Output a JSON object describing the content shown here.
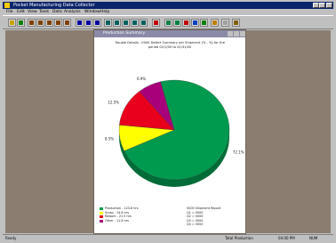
{
  "window": {
    "title": "Pocket Manufacturing Data Collector"
  },
  "menubar": {
    "items": [
      "File",
      "Edit",
      "View",
      "Tools",
      "Data",
      "Analysis",
      "Window",
      "Help"
    ]
  },
  "toolbar": {
    "buttons": [
      {
        "icon": "open-icon",
        "color": "#c8a000"
      },
      {
        "icon": "flag-icon",
        "color": "#008000"
      },
      {
        "icon": "arrow-down-icon",
        "color": "#804000"
      },
      {
        "icon": "arrow-down-icon",
        "color": "#804000"
      },
      {
        "icon": "arrow-down-icon",
        "color": "#804000"
      },
      {
        "icon": "arrow-down-icon",
        "color": "#804000"
      },
      {
        "icon": "arrow-down-icon",
        "color": "#804000"
      },
      {
        "icon": "chart-icon",
        "color": "#0000a0"
      },
      {
        "icon": "chart-icon",
        "color": "#0000a0"
      },
      {
        "icon": "chart-icon",
        "color": "#0000a0"
      },
      {
        "icon": "grid-icon",
        "color": "#006060"
      },
      {
        "icon": "grid-icon",
        "color": "#006060"
      },
      {
        "icon": "grid-icon",
        "color": "#006060"
      },
      {
        "icon": "grid-icon",
        "color": "#006060"
      },
      {
        "icon": "grid-icon",
        "color": "#006060"
      },
      {
        "icon": "page-icon",
        "color": "#c00000"
      },
      {
        "icon": "bar-chart-icon",
        "color": "#008040"
      },
      {
        "icon": "bar-chart-icon",
        "color": "#008040"
      },
      {
        "icon": "pie-chart-icon",
        "color": "#c00000"
      },
      {
        "icon": "pie-chart-icon",
        "color": "#0040c0"
      },
      {
        "icon": "globe-icon",
        "color": "#008000"
      },
      {
        "icon": "help-icon",
        "color": "#c08000"
      },
      {
        "icon": "pencil-icon",
        "color": "#a0a0a0"
      },
      {
        "icon": "pointer-icon",
        "color": "#806000"
      }
    ]
  },
  "document": {
    "title": "Production Summary",
    "chart_title_lines": [
      "Trouble Details - 0000 Defect Summary per Shipment (% - %) for the",
      "period 02/1/00 to 02/31/00"
    ]
  },
  "chart_data": {
    "type": "pie",
    "title": "",
    "slices": [
      {
        "label": "Production",
        "value_label": "72.1%",
        "value": 72.1,
        "color": "#009a4e"
      },
      {
        "label": "Scrap",
        "value_label": "8.5%",
        "value": 8.5,
        "color": "#ffff00"
      },
      {
        "label": "Rework",
        "value_label": "12.5%",
        "value": 12.5,
        "color": "#e8001c"
      },
      {
        "label": "Other",
        "value_label": "6.9%",
        "value": 6.9,
        "color": "#a8007a"
      }
    ]
  },
  "legend": {
    "entries": [
      {
        "label": "Production - 123.8 hrs",
        "color": "#009a4e"
      },
      {
        "label": "Scrap - 14.6 hrs",
        "color": "#ffff00"
      },
      {
        "label": "Rework - 21.5 hrs",
        "color": "#e8001c"
      },
      {
        "label": "Other - 11.8 hrs",
        "color": "#a8007a"
      }
    ]
  },
  "summary": {
    "lines": [
      "0000 Shipment Report",
      "Q1 = 0000",
      "Q2 = 0000",
      "Q3 = 0000",
      "Q4 = 0000"
    ]
  },
  "statusbar": {
    "left": "Ready",
    "right": [
      "Total Production",
      "04:00 PM",
      "NUM"
    ]
  }
}
